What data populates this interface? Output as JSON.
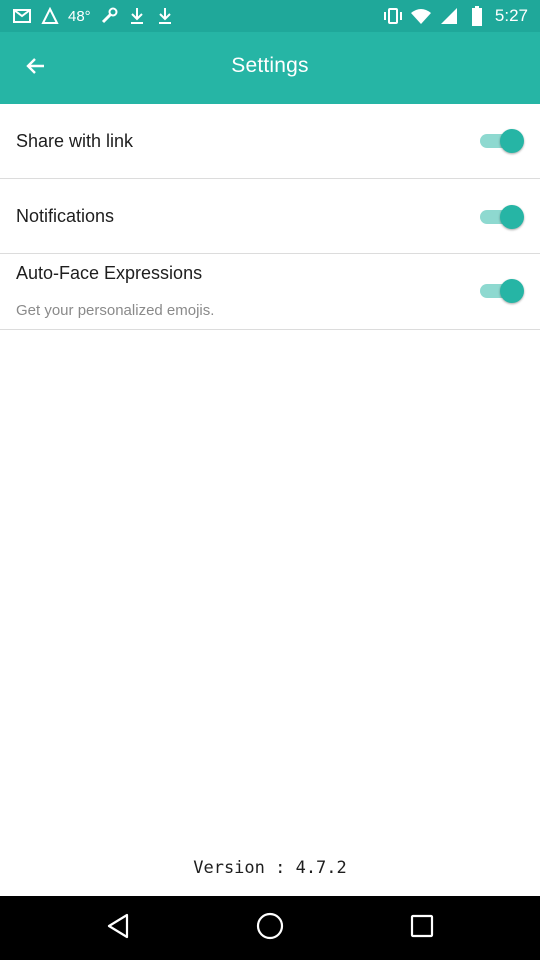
{
  "status_bar": {
    "battery_percent": "48°",
    "time": "5:27",
    "icons_left": [
      "mail-icon",
      "signal-boost-icon",
      "temperature-text",
      "wrench-icon",
      "download-icon",
      "download-icon"
    ],
    "icons_right": [
      "vibrate-icon",
      "wifi-icon",
      "cellular-icon",
      "battery-icon"
    ]
  },
  "app_bar": {
    "title": "Settings",
    "back_icon": "arrow-left-icon"
  },
  "settings": {
    "share_with_link": {
      "label": "Share with link",
      "enabled": true
    },
    "notifications": {
      "label": "Notifications",
      "enabled": true
    },
    "auto_face": {
      "label": "Auto-Face Expressions",
      "subtitle": "Get your personalized emojis.",
      "enabled": true
    }
  },
  "footer": {
    "version": "Version : 4.7.2"
  },
  "nav_bar": {
    "icons": [
      "back-triangle-icon",
      "home-circle-icon",
      "recents-square-icon"
    ]
  },
  "colors": {
    "status_bar": "#1fa89a",
    "app_bar": "#26b5a5",
    "toggle_thumb": "#26b5a5",
    "toggle_track": "#8ed9d0",
    "nav_bar": "#000000"
  }
}
